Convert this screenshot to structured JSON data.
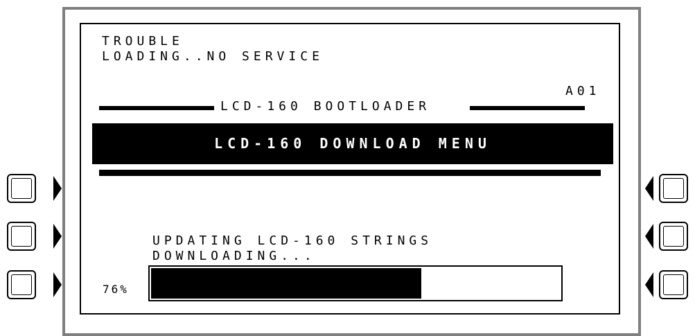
{
  "status": {
    "line1": "TROUBLE",
    "line2": "LOADING..NO SERVICE",
    "code": "A01"
  },
  "header": {
    "title": "LCD-160 BOOTLOADER"
  },
  "menu": {
    "title": "LCD-160 DOWNLOAD MENU"
  },
  "progress": {
    "message": "UPDATING LCD-160 STRINGS",
    "state": "DOWNLOADING...",
    "percent_label": "76%",
    "percent": 76
  },
  "colors": {
    "frame": "#7f7f7f",
    "lcd_fg": "#000000",
    "lcd_bg": "#ffffff"
  },
  "soft_keys": {
    "left": [
      "soft-key-left-1",
      "soft-key-left-2",
      "soft-key-left-3"
    ],
    "right": [
      "soft-key-right-1",
      "soft-key-right-2",
      "soft-key-right-3"
    ]
  }
}
